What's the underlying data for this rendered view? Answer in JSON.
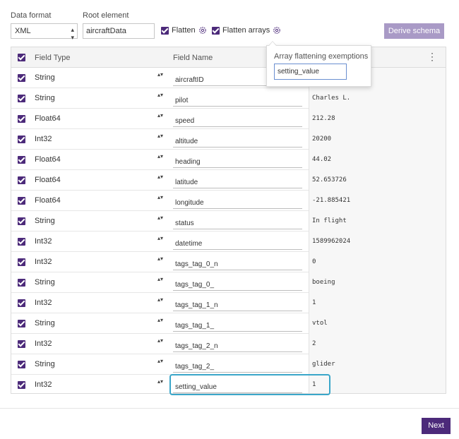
{
  "toolbar": {
    "data_format_label": "Data format",
    "data_format_value": "XML",
    "root_element_label": "Root element",
    "root_element_value": "aircraftData",
    "flatten_label": "Flatten",
    "flatten_arrays_label": "Flatten arrays",
    "derive_schema_label": "Derive schema"
  },
  "popover": {
    "title": "Array flattening exemptions",
    "input_value": "setting_value"
  },
  "grid": {
    "headers": {
      "field_type": "Field Type",
      "field_name": "Field Name"
    },
    "rows": [
      {
        "type": "String",
        "name": "aircraftID",
        "sample": ""
      },
      {
        "type": "String",
        "name": "pilot",
        "sample": "Charles L."
      },
      {
        "type": "Float64",
        "name": "speed",
        "sample": "212.28"
      },
      {
        "type": "Int32",
        "name": "altitude",
        "sample": "20200"
      },
      {
        "type": "Float64",
        "name": "heading",
        "sample": "44.02"
      },
      {
        "type": "Float64",
        "name": "latitude",
        "sample": "52.653726"
      },
      {
        "type": "Float64",
        "name": "longitude",
        "sample": "-21.885421"
      },
      {
        "type": "String",
        "name": "status",
        "sample": "In flight"
      },
      {
        "type": "Int32",
        "name": "datetime",
        "sample": "1589962024"
      },
      {
        "type": "Int32",
        "name": "tags_tag_0_n",
        "sample": "0"
      },
      {
        "type": "String",
        "name": "tags_tag_0_",
        "sample": "boeing"
      },
      {
        "type": "Int32",
        "name": "tags_tag_1_n",
        "sample": "1"
      },
      {
        "type": "String",
        "name": "tags_tag_1_",
        "sample": "vtol"
      },
      {
        "type": "Int32",
        "name": "tags_tag_2_n",
        "sample": "2"
      },
      {
        "type": "String",
        "name": "tags_tag_2_",
        "sample": "glider"
      },
      {
        "type": "Int32",
        "name": "setting_value",
        "sample": "1"
      }
    ]
  },
  "footer": {
    "next_label": "Next"
  },
  "colors": {
    "accent": "#4c2a7a",
    "derive_button": "#a99ac6",
    "highlight": "#3aa6c9"
  }
}
